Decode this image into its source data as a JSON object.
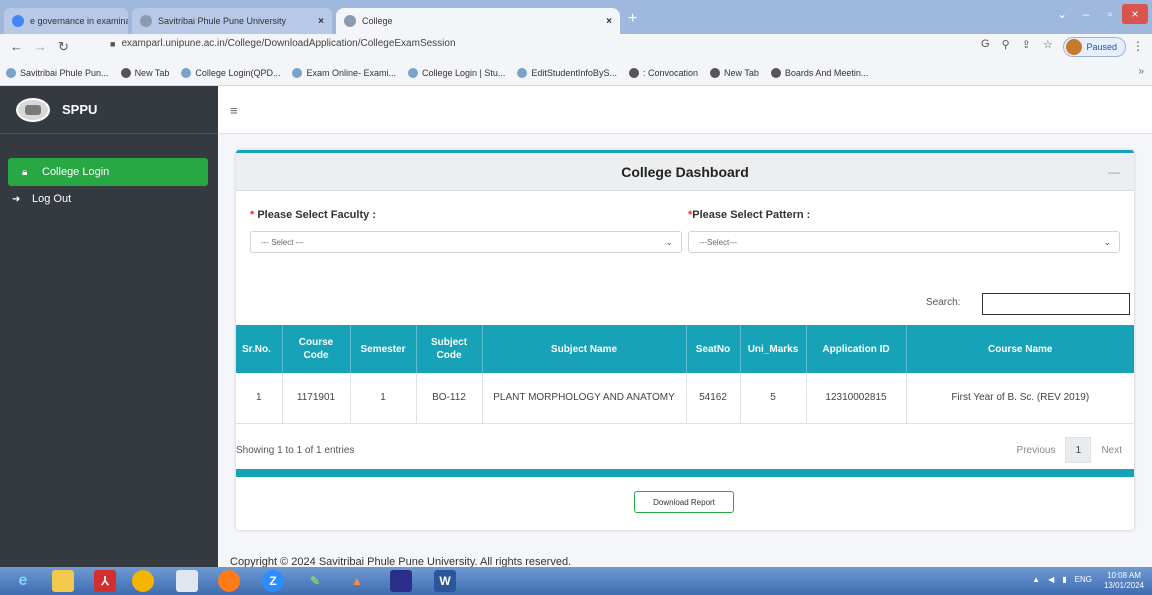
{
  "browser": {
    "tabs": [
      {
        "label": "e governance in examination - ",
        "icon": "google-icon"
      },
      {
        "label": "Savitribai Phule Pune University",
        "icon": "sppu-favicon"
      },
      {
        "label": "College",
        "icon": "sppu-favicon"
      }
    ],
    "new_tab": "+",
    "url": "examparl.unipune.ac.in/College/DownloadApplication/CollegeExamSession",
    "profile_label": "Paused",
    "bookmarks": [
      "Savitribai Phule Pun...",
      "New Tab",
      "College Login(QPD...",
      "Exam Online- Exami...",
      "College Login | Stu...",
      "EditStudentInfoByS...",
      ": Convocation",
      "New Tab",
      "Boards And Meetin..."
    ]
  },
  "sidebar": {
    "brand": "SPPU",
    "items": [
      {
        "label": "College Login",
        "icon": "lock-icon",
        "active": true
      },
      {
        "label": "Log Out",
        "icon": "logout-icon",
        "active": false
      }
    ]
  },
  "dashboard": {
    "title": "College Dashboard",
    "collapse": "—",
    "faculty_label": "Please Select Faculty :",
    "faculty_select": "--- Select ---",
    "pattern_label": "Please Select Pattern :",
    "pattern_select": "---Select---",
    "search_label": "Search:",
    "search_value": "",
    "table": {
      "headers": [
        "Sr.No.",
        "Course Code",
        "Semester",
        "Subject Code",
        "Subject Name",
        "SeatNo",
        "Uni_Marks",
        "Application ID",
        "Course Name"
      ],
      "rows": [
        [
          "1",
          "1171901",
          "1",
          "BO-112",
          "PLANT MORPHOLOGY AND ANATOMY",
          "54162",
          "5",
          "12310002815",
          "First Year of B. Sc. (REV 2019)"
        ]
      ]
    },
    "info": "Showing 1 to 1 of 1 entries",
    "pager": {
      "previous": "Previous",
      "page": "1",
      "next": "Next"
    },
    "download_button": "Download Report"
  },
  "footer": {
    "copyright": "Copyright © 2024 Savitribai Phule Pune University. All rights reserved."
  },
  "taskbar": {
    "language": "ENG",
    "time": "10:08 AM",
    "date": "13/01/2024"
  },
  "colors": {
    "accent": "#17a2b8",
    "sidebar_bg": "#343a40",
    "active_nav": "#28a745",
    "required": "#e3342f"
  }
}
